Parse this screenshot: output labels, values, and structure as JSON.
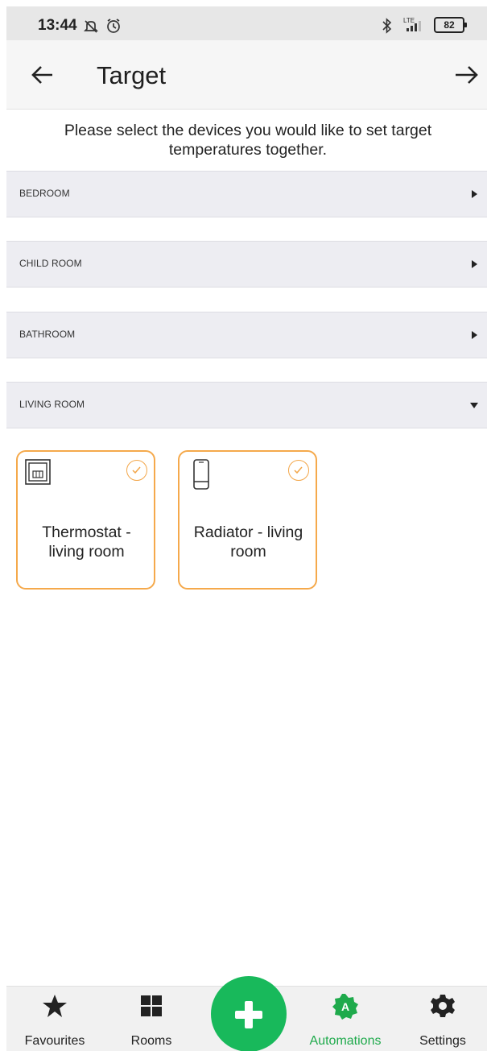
{
  "status_bar": {
    "time": "13:44",
    "battery": "82",
    "network": "LTE"
  },
  "header": {
    "title": "Target"
  },
  "instruction": "Please select the devices you would like to set target temperatures together.",
  "rooms": [
    {
      "name": "BEDROOM",
      "expanded": false
    },
    {
      "name": "CHILD ROOM",
      "expanded": false
    },
    {
      "name": "BATHROOM",
      "expanded": false
    },
    {
      "name": "LIVING ROOM",
      "expanded": true
    }
  ],
  "devices": [
    {
      "name": "Thermostat - living room",
      "icon": "thermostat-icon",
      "selected": true
    },
    {
      "name": "Radiator - living room",
      "icon": "radiator-icon",
      "selected": true
    }
  ],
  "bottom_nav": {
    "items": [
      {
        "label": "Favourites",
        "icon": "star-icon"
      },
      {
        "label": "Rooms",
        "icon": "grid-icon"
      },
      {
        "label": "Automations",
        "icon": "automation-icon",
        "active": true
      },
      {
        "label": "Settings",
        "icon": "gear-icon"
      }
    ],
    "fab_icon": "plus-icon"
  },
  "colors": {
    "accent_orange": "#f5a94b",
    "brand_green": "#18b95b",
    "active_green": "#1faa4c"
  }
}
